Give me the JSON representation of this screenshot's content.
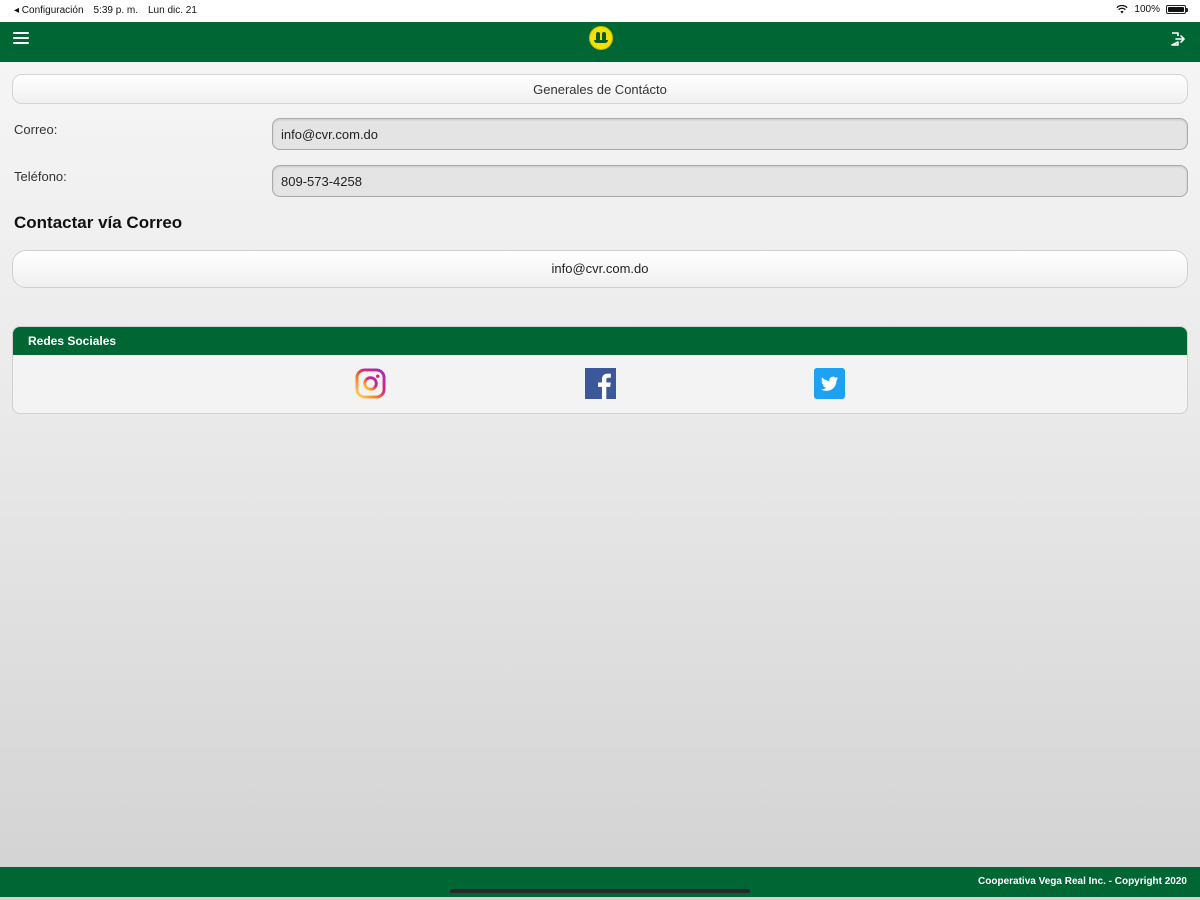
{
  "status_bar": {
    "back_label": "◂ Configuración",
    "time": "5:39 p. m.",
    "date": "Lun dic. 21",
    "battery": "100%"
  },
  "header": {
    "menu_icon": "hamburger-menu-icon",
    "logo_icon": "cooperative-logo-icon",
    "logout_icon": "logout-icon",
    "color": "#006633"
  },
  "contact": {
    "section_title": "Generales de Contácto",
    "email_label": "Correo:",
    "email_value": "info@cvr.com.do",
    "phone_label": "Teléfono:",
    "phone_value": "809-573-4258"
  },
  "contact_email": {
    "heading": "Contactar vía Correo",
    "button_label": "info@cvr.com.do"
  },
  "social": {
    "title": "Redes Sociales",
    "icons": [
      "instagram-icon",
      "facebook-icon",
      "twitter-icon"
    ]
  },
  "footer": {
    "copyright": "Cooperativa Vega Real Inc. - Copyright 2020"
  }
}
